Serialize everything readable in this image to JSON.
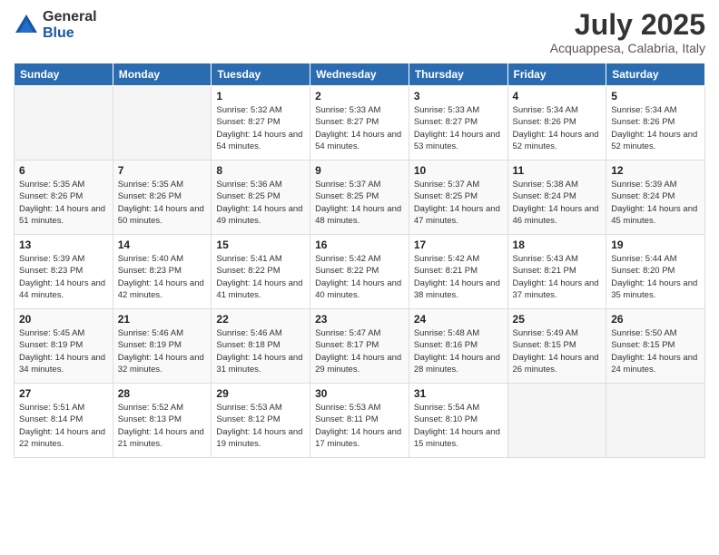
{
  "logo": {
    "general": "General",
    "blue": "Blue"
  },
  "title": "July 2025",
  "subtitle": "Acquappesa, Calabria, Italy",
  "weekdays": [
    "Sunday",
    "Monday",
    "Tuesday",
    "Wednesday",
    "Thursday",
    "Friday",
    "Saturday"
  ],
  "weeks": [
    [
      {
        "day": "",
        "sunrise": "",
        "sunset": "",
        "daylight": ""
      },
      {
        "day": "",
        "sunrise": "",
        "sunset": "",
        "daylight": ""
      },
      {
        "day": "1",
        "sunrise": "Sunrise: 5:32 AM",
        "sunset": "Sunset: 8:27 PM",
        "daylight": "Daylight: 14 hours and 54 minutes."
      },
      {
        "day": "2",
        "sunrise": "Sunrise: 5:33 AM",
        "sunset": "Sunset: 8:27 PM",
        "daylight": "Daylight: 14 hours and 54 minutes."
      },
      {
        "day": "3",
        "sunrise": "Sunrise: 5:33 AM",
        "sunset": "Sunset: 8:27 PM",
        "daylight": "Daylight: 14 hours and 53 minutes."
      },
      {
        "day": "4",
        "sunrise": "Sunrise: 5:34 AM",
        "sunset": "Sunset: 8:26 PM",
        "daylight": "Daylight: 14 hours and 52 minutes."
      },
      {
        "day": "5",
        "sunrise": "Sunrise: 5:34 AM",
        "sunset": "Sunset: 8:26 PM",
        "daylight": "Daylight: 14 hours and 52 minutes."
      }
    ],
    [
      {
        "day": "6",
        "sunrise": "Sunrise: 5:35 AM",
        "sunset": "Sunset: 8:26 PM",
        "daylight": "Daylight: 14 hours and 51 minutes."
      },
      {
        "day": "7",
        "sunrise": "Sunrise: 5:35 AM",
        "sunset": "Sunset: 8:26 PM",
        "daylight": "Daylight: 14 hours and 50 minutes."
      },
      {
        "day": "8",
        "sunrise": "Sunrise: 5:36 AM",
        "sunset": "Sunset: 8:25 PM",
        "daylight": "Daylight: 14 hours and 49 minutes."
      },
      {
        "day": "9",
        "sunrise": "Sunrise: 5:37 AM",
        "sunset": "Sunset: 8:25 PM",
        "daylight": "Daylight: 14 hours and 48 minutes."
      },
      {
        "day": "10",
        "sunrise": "Sunrise: 5:37 AM",
        "sunset": "Sunset: 8:25 PM",
        "daylight": "Daylight: 14 hours and 47 minutes."
      },
      {
        "day": "11",
        "sunrise": "Sunrise: 5:38 AM",
        "sunset": "Sunset: 8:24 PM",
        "daylight": "Daylight: 14 hours and 46 minutes."
      },
      {
        "day": "12",
        "sunrise": "Sunrise: 5:39 AM",
        "sunset": "Sunset: 8:24 PM",
        "daylight": "Daylight: 14 hours and 45 minutes."
      }
    ],
    [
      {
        "day": "13",
        "sunrise": "Sunrise: 5:39 AM",
        "sunset": "Sunset: 8:23 PM",
        "daylight": "Daylight: 14 hours and 44 minutes."
      },
      {
        "day": "14",
        "sunrise": "Sunrise: 5:40 AM",
        "sunset": "Sunset: 8:23 PM",
        "daylight": "Daylight: 14 hours and 42 minutes."
      },
      {
        "day": "15",
        "sunrise": "Sunrise: 5:41 AM",
        "sunset": "Sunset: 8:22 PM",
        "daylight": "Daylight: 14 hours and 41 minutes."
      },
      {
        "day": "16",
        "sunrise": "Sunrise: 5:42 AM",
        "sunset": "Sunset: 8:22 PM",
        "daylight": "Daylight: 14 hours and 40 minutes."
      },
      {
        "day": "17",
        "sunrise": "Sunrise: 5:42 AM",
        "sunset": "Sunset: 8:21 PM",
        "daylight": "Daylight: 14 hours and 38 minutes."
      },
      {
        "day": "18",
        "sunrise": "Sunrise: 5:43 AM",
        "sunset": "Sunset: 8:21 PM",
        "daylight": "Daylight: 14 hours and 37 minutes."
      },
      {
        "day": "19",
        "sunrise": "Sunrise: 5:44 AM",
        "sunset": "Sunset: 8:20 PM",
        "daylight": "Daylight: 14 hours and 35 minutes."
      }
    ],
    [
      {
        "day": "20",
        "sunrise": "Sunrise: 5:45 AM",
        "sunset": "Sunset: 8:19 PM",
        "daylight": "Daylight: 14 hours and 34 minutes."
      },
      {
        "day": "21",
        "sunrise": "Sunrise: 5:46 AM",
        "sunset": "Sunset: 8:19 PM",
        "daylight": "Daylight: 14 hours and 32 minutes."
      },
      {
        "day": "22",
        "sunrise": "Sunrise: 5:46 AM",
        "sunset": "Sunset: 8:18 PM",
        "daylight": "Daylight: 14 hours and 31 minutes."
      },
      {
        "day": "23",
        "sunrise": "Sunrise: 5:47 AM",
        "sunset": "Sunset: 8:17 PM",
        "daylight": "Daylight: 14 hours and 29 minutes."
      },
      {
        "day": "24",
        "sunrise": "Sunrise: 5:48 AM",
        "sunset": "Sunset: 8:16 PM",
        "daylight": "Daylight: 14 hours and 28 minutes."
      },
      {
        "day": "25",
        "sunrise": "Sunrise: 5:49 AM",
        "sunset": "Sunset: 8:15 PM",
        "daylight": "Daylight: 14 hours and 26 minutes."
      },
      {
        "day": "26",
        "sunrise": "Sunrise: 5:50 AM",
        "sunset": "Sunset: 8:15 PM",
        "daylight": "Daylight: 14 hours and 24 minutes."
      }
    ],
    [
      {
        "day": "27",
        "sunrise": "Sunrise: 5:51 AM",
        "sunset": "Sunset: 8:14 PM",
        "daylight": "Daylight: 14 hours and 22 minutes."
      },
      {
        "day": "28",
        "sunrise": "Sunrise: 5:52 AM",
        "sunset": "Sunset: 8:13 PM",
        "daylight": "Daylight: 14 hours and 21 minutes."
      },
      {
        "day": "29",
        "sunrise": "Sunrise: 5:53 AM",
        "sunset": "Sunset: 8:12 PM",
        "daylight": "Daylight: 14 hours and 19 minutes."
      },
      {
        "day": "30",
        "sunrise": "Sunrise: 5:53 AM",
        "sunset": "Sunset: 8:11 PM",
        "daylight": "Daylight: 14 hours and 17 minutes."
      },
      {
        "day": "31",
        "sunrise": "Sunrise: 5:54 AM",
        "sunset": "Sunset: 8:10 PM",
        "daylight": "Daylight: 14 hours and 15 minutes."
      },
      {
        "day": "",
        "sunrise": "",
        "sunset": "",
        "daylight": ""
      },
      {
        "day": "",
        "sunrise": "",
        "sunset": "",
        "daylight": ""
      }
    ]
  ]
}
